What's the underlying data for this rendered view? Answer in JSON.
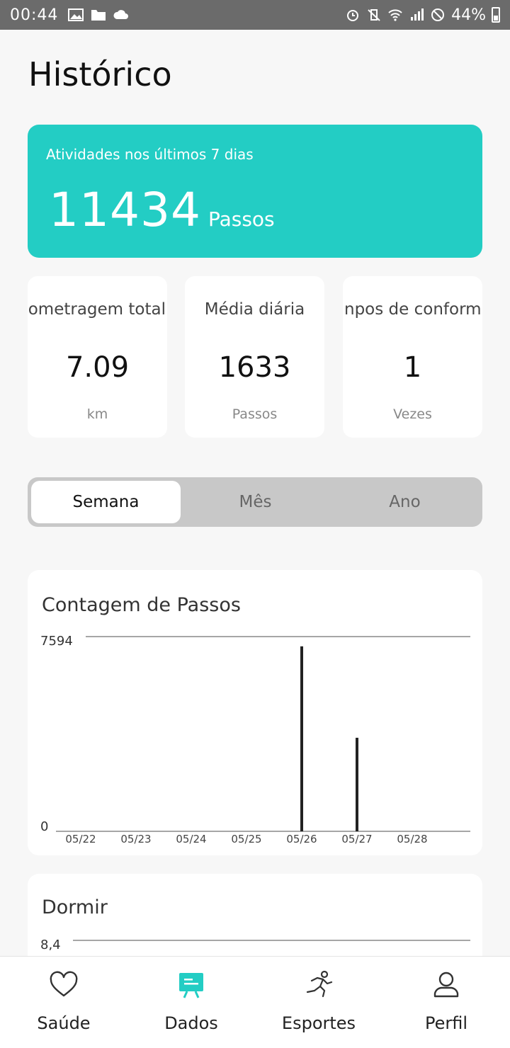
{
  "status_bar": {
    "time": "00:44",
    "battery": "44%"
  },
  "page_title": "Histórico",
  "summary": {
    "label": "Atividades nos últimos 7 dias",
    "value": "11434",
    "unit": "Passos"
  },
  "stats": [
    {
      "title": "ometragem total",
      "value": "7.09",
      "unit": "km"
    },
    {
      "title": "Média diária",
      "value": "1633",
      "unit": "Passos"
    },
    {
      "title": "npos de conformic",
      "value": "1",
      "unit": "Vezes"
    }
  ],
  "segments": [
    {
      "label": "Semana",
      "active": true
    },
    {
      "label": "Mês",
      "active": false
    },
    {
      "label": "Ano",
      "active": false
    }
  ],
  "steps_chart": {
    "title": "Contagem de Passos",
    "y_max_label": "7594",
    "y_min_label": "0"
  },
  "sleep_chart": {
    "title": "Dormir",
    "y_max_label": "8,4"
  },
  "chart_data": [
    {
      "type": "bar",
      "title": "Contagem de Passos",
      "categories": [
        "05/22",
        "05/23",
        "05/24",
        "05/25",
        "05/26",
        "05/27",
        "05/28"
      ],
      "values": [
        0,
        0,
        0,
        0,
        7594,
        3840,
        0
      ],
      "ylim": [
        0,
        7594
      ],
      "grid": true
    },
    {
      "type": "bar",
      "title": "Dormir",
      "ylim": [
        0,
        8.4
      ]
    }
  ],
  "bottom_nav": [
    {
      "label": "Saúde",
      "icon": "heart-icon",
      "active": false
    },
    {
      "label": "Dados",
      "icon": "data-board-icon",
      "active": true
    },
    {
      "label": "Esportes",
      "icon": "runner-icon",
      "active": false
    },
    {
      "label": "Perfil",
      "icon": "person-icon",
      "active": false
    }
  ],
  "colors": {
    "accent": "#23cdc4",
    "bar": "#222222"
  }
}
